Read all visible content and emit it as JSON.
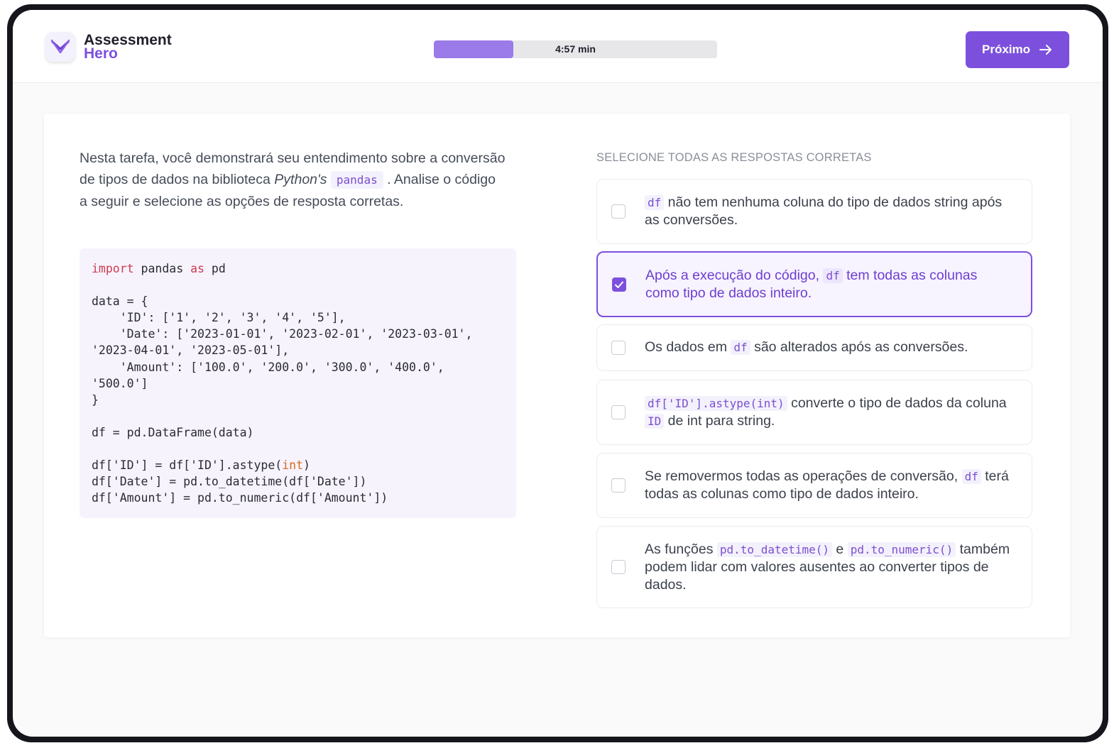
{
  "app": {
    "logo_line1": "Assessment",
    "logo_line2": "Hero"
  },
  "timer": {
    "label": "4:57 min",
    "progress_fraction": 0.28
  },
  "next_button": {
    "label": "Próximo"
  },
  "intro": {
    "part1": "Nesta tarefa, você demonstrará seu entendimento sobre a conversão de tipos de dados na biblioteca ",
    "python": "Python's",
    "pandas": "pandas",
    "part2": ". Analise o código a seguir e selecione as opções de resposta corretas."
  },
  "code": {
    "l1_import": "import",
    "l1_mid": " pandas ",
    "l1_as": "as",
    "l1_end": " pd",
    "l3": "data = {",
    "l4": "    'ID': ['1', '2', '3', '4', '5'],",
    "l5": "    'Date': ['2023-01-01', '2023-02-01', '2023-03-01',",
    "l6": "'2023-04-01', '2023-05-01'],",
    "l7": "    'Amount': ['100.0', '200.0', '300.0', '400.0',",
    "l8": "'500.0']",
    "l9": "}",
    "l11": "df = pd.DataFrame(data)",
    "l13_a": "df['ID'] = df['ID'].astype(",
    "l13_int": "int",
    "l13_b": ")",
    "l14": "df['Date'] = pd.to_datetime(df['Date'])",
    "l15": "df['Amount'] = pd.to_numeric(df['Amount'])"
  },
  "question": {
    "label": "SELECIONE TODAS AS RESPOSTAS CORRETAS",
    "options": [
      {
        "selected": false,
        "t1": "df",
        "t2": " não tem nenhuma coluna do tipo de dados string após as conversões."
      },
      {
        "selected": true,
        "t1": "Após a execução do código, ",
        "t2": "df",
        "t3": " tem todas as colunas como tipo de dados inteiro."
      },
      {
        "selected": false,
        "t1": "Os dados em ",
        "t2": "df",
        "t3": " são alterados após as conversões."
      },
      {
        "selected": false,
        "t1": "df['ID'].astype(int)",
        "t2": " converte o tipo de dados da coluna ",
        "t3": "ID",
        "t4": " de int para string."
      },
      {
        "selected": false,
        "t1": "Se removermos todas as operações de conversão, ",
        "t2": "df",
        "t3": " terá todas as colunas como tipo de dados inteiro."
      },
      {
        "selected": false,
        "t1": "As funções ",
        "t2": "pd.to_datetime()",
        "t3": " e ",
        "t4": "pd.to_numeric()",
        "t5": " também podem lidar com valores ausentes ao converter tipos de dados."
      }
    ]
  },
  "colors": {
    "accent": "#7c50dd",
    "progress_fill": "#9a7be9",
    "code_background": "#f6f3fd"
  }
}
